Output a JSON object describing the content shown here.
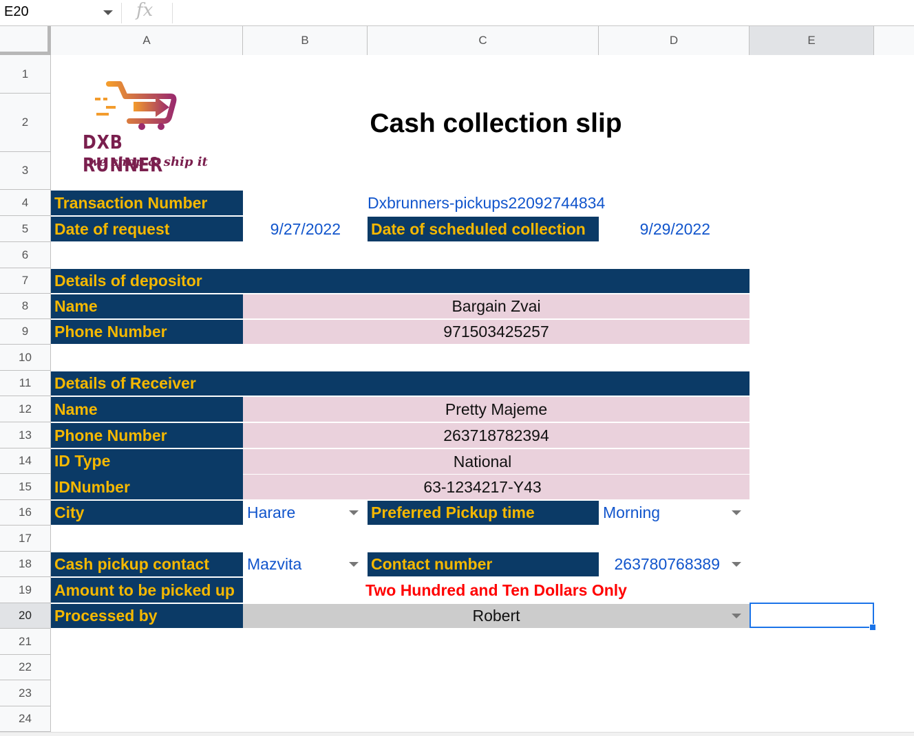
{
  "formula_bar": {
    "name_box": "E20",
    "fx": "fx"
  },
  "columns": [
    "A",
    "B",
    "C",
    "D",
    "E"
  ],
  "rows": [
    "1",
    "2",
    "3",
    "4",
    "5",
    "6",
    "7",
    "8",
    "9",
    "10",
    "11",
    "12",
    "13",
    "14",
    "15",
    "16",
    "17",
    "18",
    "19",
    "20",
    "21",
    "22",
    "23",
    "24"
  ],
  "logo": {
    "name": "DXB RUNNER",
    "tagline": "we shop & ship it"
  },
  "title": "Cash collection slip",
  "transaction": {
    "label": "Transaction Number",
    "value": "Dxbrunners-pickups22092744834"
  },
  "request": {
    "label": "Date of request",
    "value": "9/27/2022",
    "sched_label": "Date of scheduled collection",
    "sched_value": "9/29/2022"
  },
  "depositor": {
    "heading": "Details of depositor",
    "name_label": "Name",
    "name": "Bargain Zvai",
    "phone_label": "Phone Number",
    "phone": "971503425257"
  },
  "receiver": {
    "heading": "Details of Receiver",
    "name_label": "Name",
    "name": "Pretty Majeme",
    "phone_label": "Phone Number",
    "phone": "263718782394",
    "idtype_label": "ID Type",
    "idtype": "National",
    "idnum_label": "IDNumber",
    "idnum": "63-1234217-Y43"
  },
  "city": {
    "label": "City",
    "value": "Harare",
    "pickup_label": "Preferred Pickup time",
    "pickup_value": "Morning"
  },
  "cash": {
    "label": "Cash pickup contact",
    "value": "Mazvita",
    "contact_label": "Contact number",
    "contact_value": "263780768389"
  },
  "amount": {
    "label": "Amount to be picked up",
    "value": "Two Hundred and Ten Dollars Only"
  },
  "processed": {
    "label": "Processed by",
    "value": "Robert"
  },
  "colors": {
    "header_bg": "#0b3a66",
    "header_text": "#f5b800",
    "pink": "#ead1dc",
    "link_blue": "#1155cc",
    "amount_red": "#ff0000",
    "selection": "#1a73e8"
  }
}
